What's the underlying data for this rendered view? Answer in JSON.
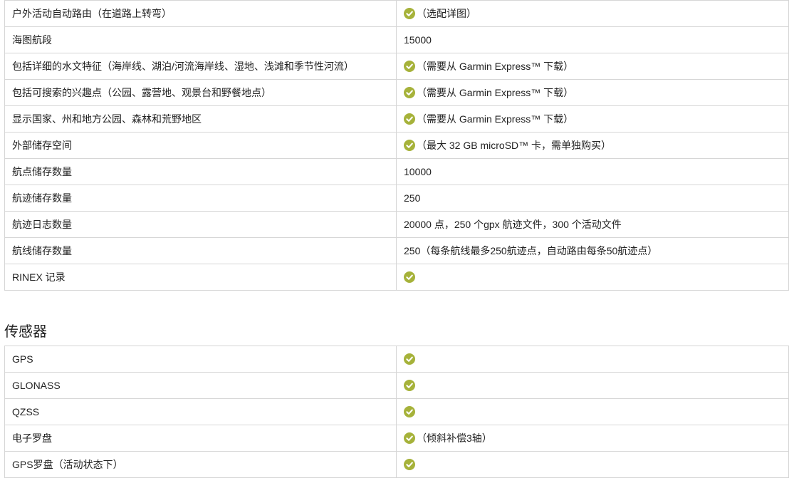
{
  "colors": {
    "check": "#a6b23a",
    "border": "#d6d6d6",
    "text": "#222222"
  },
  "table_1": {
    "rows": [
      {
        "label": "户外活动自动路由（在道路上转弯）",
        "check": true,
        "value": "（选配详图）"
      },
      {
        "label": "海图航段",
        "check": false,
        "value": "15000"
      },
      {
        "label": "包括详细的水文特征（海岸线、湖泊/河流海岸线、湿地、浅滩和季节性河流）",
        "check": true,
        "value": "（需要从 Garmin Express™ 下载）"
      },
      {
        "label": "包括可搜索的兴趣点（公园、露营地、观景台和野餐地点）",
        "check": true,
        "value": "（需要从 Garmin Express™ 下载）"
      },
      {
        "label": "显示国家、州和地方公园、森林和荒野地区",
        "check": true,
        "value": "（需要从 Garmin Express™ 下载）"
      },
      {
        "label": "外部储存空间",
        "check": true,
        "value": "（最大 32 GB microSD™ 卡，需单独购买）"
      },
      {
        "label": "航点储存数量",
        "check": false,
        "value": "10000"
      },
      {
        "label": "航迹储存数量",
        "check": false,
        "value": "250"
      },
      {
        "label": "航迹日志数量",
        "check": false,
        "value": "20000 点，250 个gpx 航迹文件，300 个活动文件"
      },
      {
        "label": "航线储存数量",
        "check": false,
        "value": "250（每条航线最多250航迹点，自动路由每条50航迹点）"
      },
      {
        "label": "RINEX 记录",
        "check": true,
        "value": ""
      }
    ]
  },
  "sensors": {
    "heading": "传感器",
    "rows": [
      {
        "label": "GPS",
        "check": true,
        "value": ""
      },
      {
        "label": "GLONASS",
        "check": true,
        "value": ""
      },
      {
        "label": "QZSS",
        "check": true,
        "value": ""
      },
      {
        "label": "电子罗盘",
        "check": true,
        "value": "（倾斜补偿3轴）"
      },
      {
        "label": "GPS罗盘（活动状态下）",
        "check": true,
        "value": ""
      }
    ]
  }
}
